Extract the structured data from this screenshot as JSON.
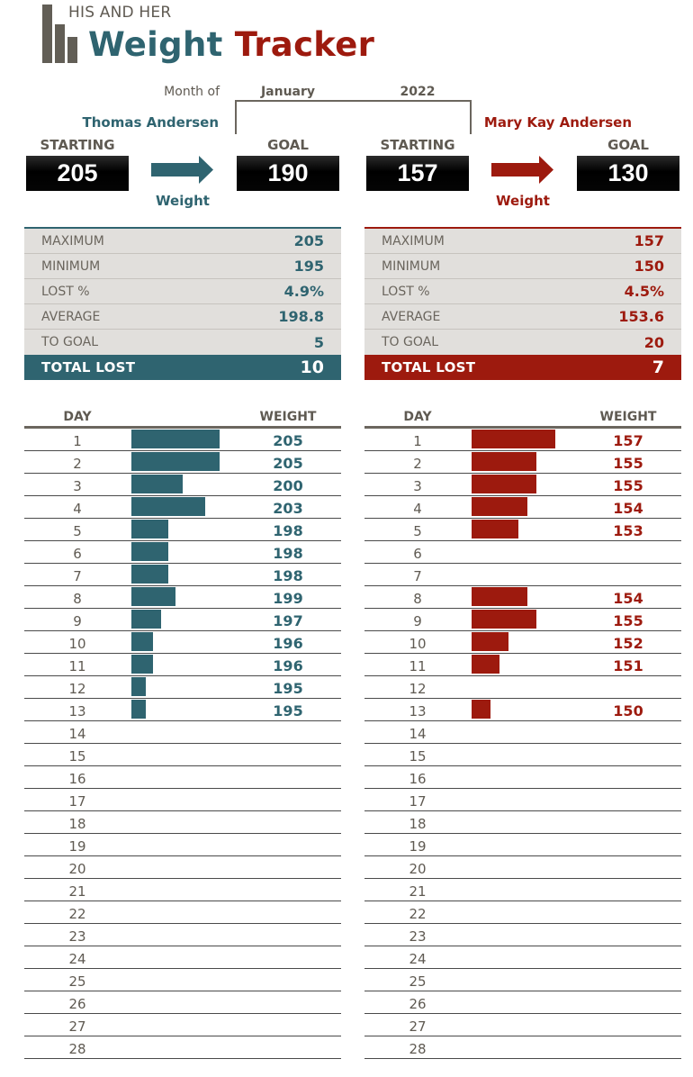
{
  "header": {
    "subtitle": "HIS AND HER",
    "title_part1": "Weight",
    "title_part2": "Tracker",
    "month_of_label": "Month of",
    "month": "January",
    "year": "2022"
  },
  "colors": {
    "his_accent": "#2f6470",
    "her_accent": "#9d1a0e",
    "panel_bg": "#e1dfdc",
    "logo": "#625e56"
  },
  "his": {
    "name": "Thomas Andersen",
    "starting_label": "STARTING",
    "starting": "205",
    "goal_label": "GOAL",
    "goal": "190",
    "arrow_label": "Weight",
    "stats": [
      {
        "label": "MAXIMUM",
        "value": "205"
      },
      {
        "label": "MINIMUM",
        "value": "195"
      },
      {
        "label": "LOST %",
        "value": "4.9%"
      },
      {
        "label": "AVERAGE",
        "value": "198.8"
      },
      {
        "label": "TO GOAL",
        "value": "5"
      }
    ],
    "total_lost_label": "TOTAL LOST",
    "total_lost": "10",
    "table_day_header": "DAY",
    "table_weight_header": "WEIGHT",
    "daily": [
      205,
      205,
      200,
      203,
      198,
      198,
      198,
      199,
      197,
      196,
      196,
      195,
      195,
      null,
      null,
      null,
      null,
      null,
      null,
      null,
      null,
      null,
      null,
      null,
      null,
      null,
      null,
      null
    ]
  },
  "her": {
    "name": "Mary Kay Andersen",
    "starting_label": "STARTING",
    "starting": "157",
    "goal_label": "GOAL",
    "goal": "130",
    "arrow_label": "Weight",
    "stats": [
      {
        "label": "MAXIMUM",
        "value": "157"
      },
      {
        "label": "MINIMUM",
        "value": "150"
      },
      {
        "label": "LOST %",
        "value": "4.5%"
      },
      {
        "label": "AVERAGE",
        "value": "153.6"
      },
      {
        "label": "TO GOAL",
        "value": "20"
      }
    ],
    "total_lost_label": "TOTAL LOST",
    "total_lost": "7",
    "table_day_header": "DAY",
    "table_weight_header": "WEIGHT",
    "daily": [
      157,
      155,
      155,
      154,
      153,
      null,
      null,
      154,
      155,
      152,
      151,
      null,
      150,
      null,
      null,
      null,
      null,
      null,
      null,
      null,
      null,
      null,
      null,
      null,
      null,
      null,
      null,
      null
    ]
  },
  "days": [
    1,
    2,
    3,
    4,
    5,
    6,
    7,
    8,
    9,
    10,
    11,
    12,
    13,
    14,
    15,
    16,
    17,
    18,
    19,
    20,
    21,
    22,
    23,
    24,
    25,
    26,
    27,
    28
  ]
}
